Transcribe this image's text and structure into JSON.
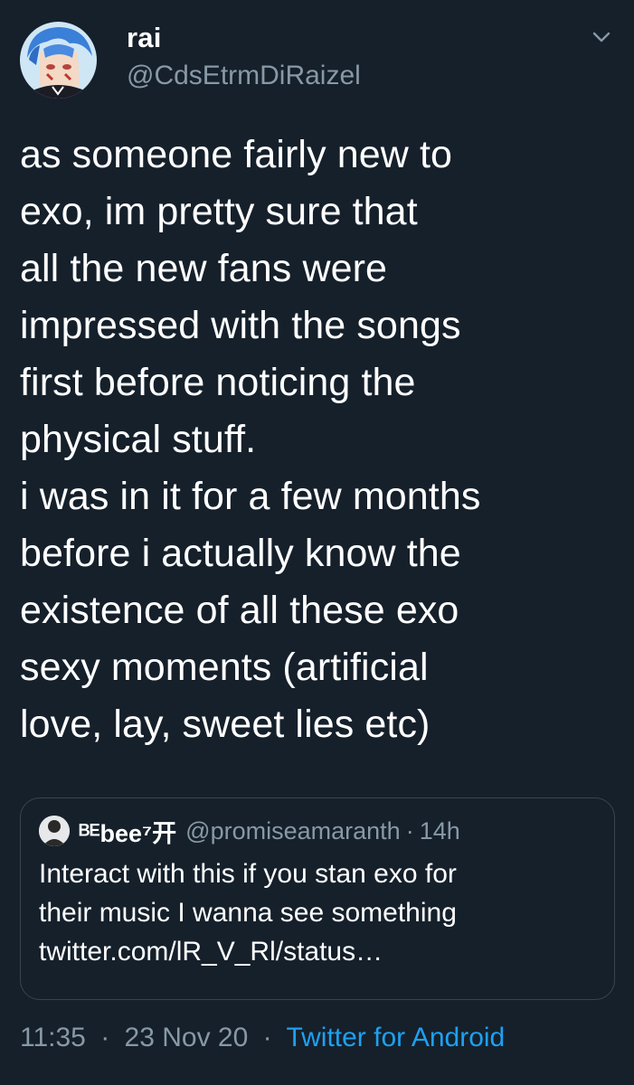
{
  "author": {
    "display_name": "rai",
    "handle": "@CdsEtrmDiRaizel",
    "avatar_icon": "anime-avatar"
  },
  "tweet": {
    "text": "as someone fairly new to\nexo, im pretty sure that\nall the new fans were\nimpressed with the songs\nfirst before noticing the\nphysical stuff.\ni was in it for a few months\nbefore i actually know the\nexistence of all these exo\nsexy moments (artificial\nlove, lay, sweet lies etc)",
    "time": "11:35",
    "date": "23 Nov 20",
    "separator": "·",
    "source": "Twitter for Android"
  },
  "quoted_tweet": {
    "display_name": "ᴮᴱbee⁷开",
    "handle": "@promiseamaranth",
    "separator": "·",
    "time_ago": "14h",
    "text": "Interact with this if you stan exo for\ntheir music I wanna see something\ntwitter.com/lR_V_Rl/status…"
  },
  "colors": {
    "background": "#15202b",
    "text": "#ffffff",
    "secondary": "#8899a6",
    "link": "#1da1f2",
    "border": "#38444d"
  },
  "icons": {
    "more": "chevron-down-icon"
  }
}
